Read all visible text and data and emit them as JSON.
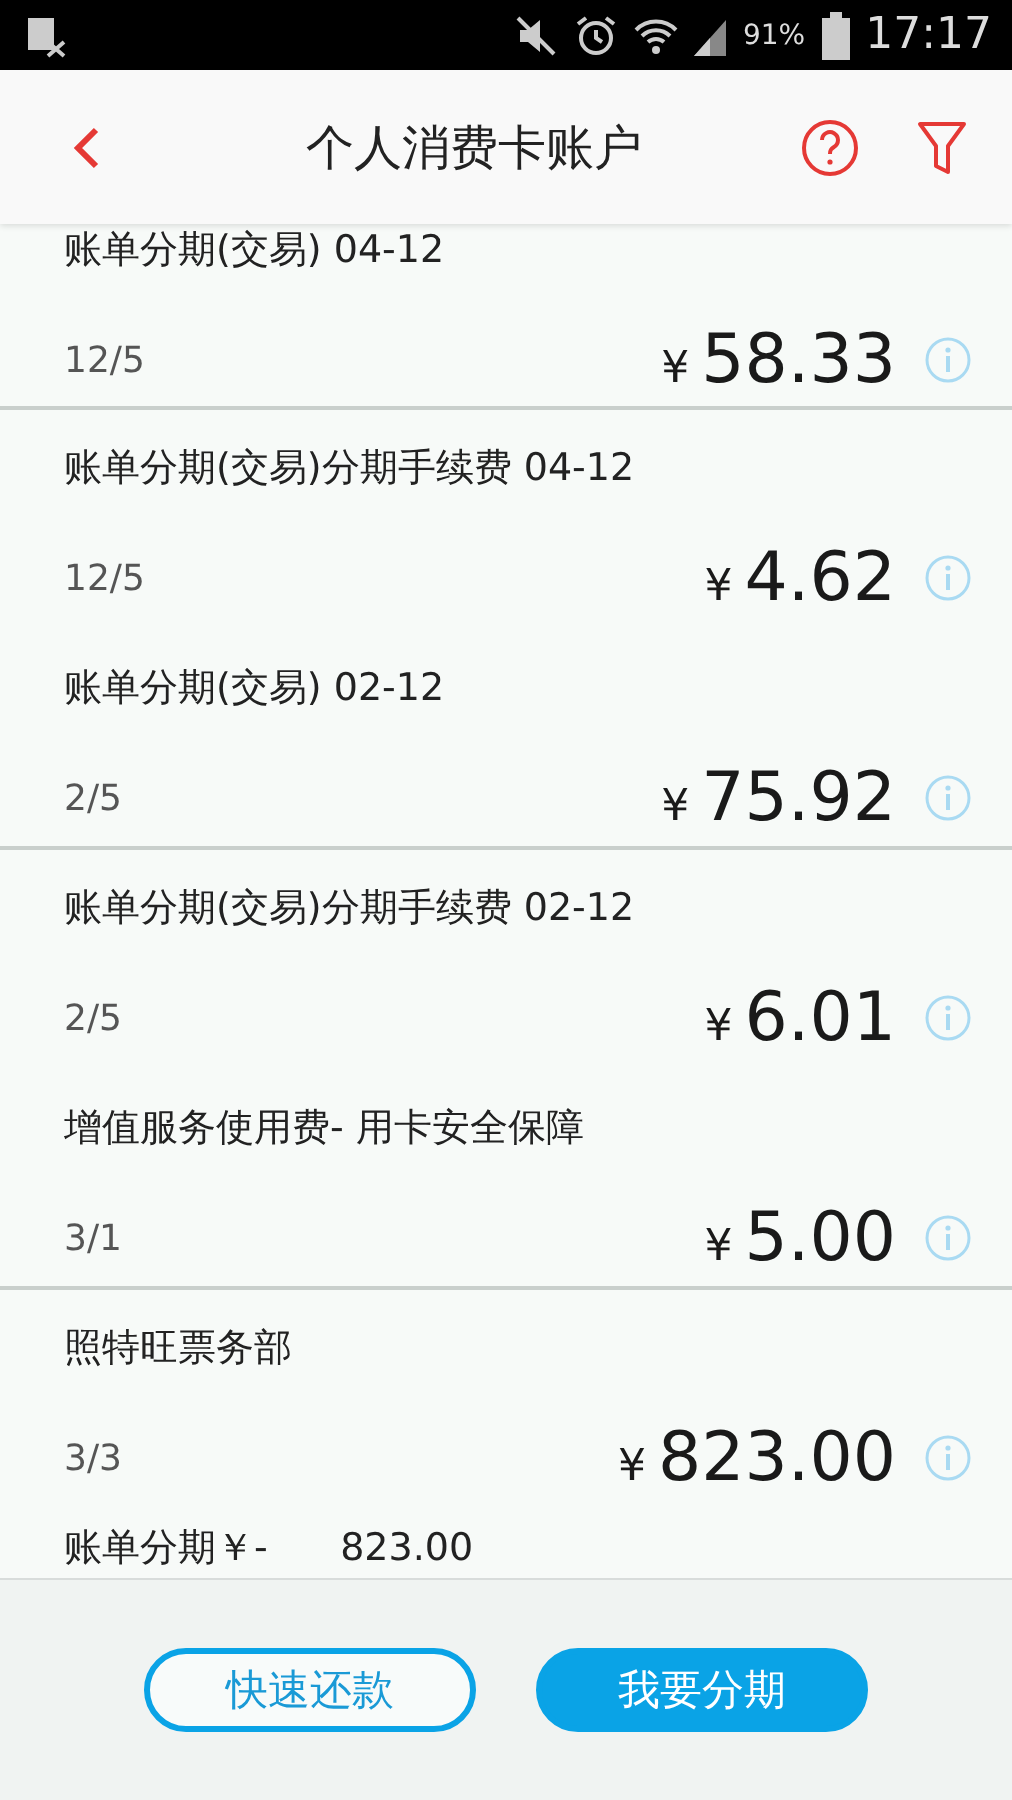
{
  "status_bar": {
    "battery_text": "91%",
    "time": "17:17"
  },
  "header": {
    "title": "个人消费卡账户"
  },
  "transactions": [
    {
      "title": "账单分期(交易) 04-12",
      "date": "12/5",
      "currency": "¥",
      "amount": "58.33",
      "separator": true
    },
    {
      "title": "账单分期(交易)分期手续费 04-12",
      "date": "12/5",
      "currency": "¥",
      "amount": "4.62",
      "separator": false
    },
    {
      "title": "账单分期(交易) 02-12",
      "date": "2/5",
      "currency": "¥",
      "amount": "75.92",
      "separator": true
    },
    {
      "title": "账单分期(交易)分期手续费 02-12",
      "date": "2/5",
      "currency": "¥",
      "amount": "6.01",
      "separator": false
    },
    {
      "title": "增值服务使用费- 用卡安全保障",
      "date": "3/1",
      "currency": "¥",
      "amount": "5.00",
      "separator": true
    },
    {
      "title": "照特旺票务部",
      "date": "3/3",
      "currency": "¥",
      "amount": "823.00",
      "separator": false
    },
    {
      "title": "账单分期￥-      823.00"
    }
  ],
  "actions": [
    {
      "label": "快速还款",
      "kind": "outline"
    },
    {
      "label": "我要分期",
      "kind": "filled"
    }
  ]
}
